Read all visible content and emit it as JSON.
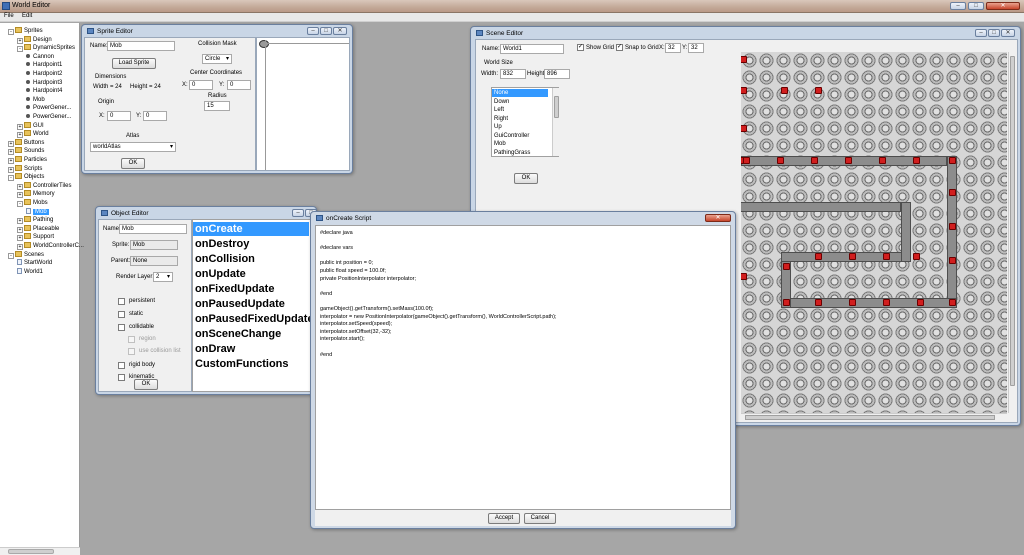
{
  "app": {
    "title": "World Editor"
  },
  "menu": [
    "File",
    "Edit"
  ],
  "tree": [
    {
      "label": "Sprites",
      "level": 0,
      "kind": "folder",
      "exp": "-"
    },
    {
      "label": "Design",
      "level": 1,
      "kind": "folder",
      "exp": "+"
    },
    {
      "label": "DynamicSprites",
      "level": 1,
      "kind": "folder",
      "exp": "-"
    },
    {
      "label": "Cannon",
      "level": 2,
      "kind": "bullet"
    },
    {
      "label": "Hardpoint1",
      "level": 2,
      "kind": "bullet"
    },
    {
      "label": "Hardpoint2",
      "level": 2,
      "kind": "bullet"
    },
    {
      "label": "Hardpoint3",
      "level": 2,
      "kind": "bullet"
    },
    {
      "label": "Hardpoint4",
      "level": 2,
      "kind": "bullet"
    },
    {
      "label": "Mob",
      "level": 2,
      "kind": "bullet"
    },
    {
      "label": "PowerGener...",
      "level": 2,
      "kind": "bullet"
    },
    {
      "label": "PowerGener...",
      "level": 2,
      "kind": "bullet"
    },
    {
      "label": "GUI",
      "level": 1,
      "kind": "folder",
      "exp": "+"
    },
    {
      "label": "World",
      "level": 1,
      "kind": "folder",
      "exp": "+"
    },
    {
      "label": "Buttons",
      "level": 0,
      "kind": "folder",
      "exp": "+"
    },
    {
      "label": "Sounds",
      "level": 0,
      "kind": "folder",
      "exp": "+"
    },
    {
      "label": "Particles",
      "level": 0,
      "kind": "folder",
      "exp": "+"
    },
    {
      "label": "Scripts",
      "level": 0,
      "kind": "folder",
      "exp": "+"
    },
    {
      "label": "Objects",
      "level": 0,
      "kind": "folder",
      "exp": "-"
    },
    {
      "label": "ControllerTiles",
      "level": 1,
      "kind": "folder",
      "exp": "+"
    },
    {
      "label": "Memory",
      "level": 1,
      "kind": "folder",
      "exp": "+"
    },
    {
      "label": "Mobs",
      "level": 1,
      "kind": "folder",
      "exp": "-"
    },
    {
      "label": "Mob",
      "level": 2,
      "kind": "page",
      "selected": true
    },
    {
      "label": "Pathing",
      "level": 1,
      "kind": "folder",
      "exp": "+"
    },
    {
      "label": "Placeable",
      "level": 1,
      "kind": "folder",
      "exp": "+"
    },
    {
      "label": "Support",
      "level": 1,
      "kind": "folder",
      "exp": "+"
    },
    {
      "label": "WorldControllerC...",
      "level": 1,
      "kind": "folder",
      "exp": "+"
    },
    {
      "label": "Scenes",
      "level": 0,
      "kind": "folder",
      "exp": "-"
    },
    {
      "label": "StartWorld",
      "level": 1,
      "kind": "page"
    },
    {
      "label": "World1",
      "level": 1,
      "kind": "page"
    }
  ],
  "sprite_editor": {
    "title": "Sprite Editor",
    "name_label": "Name:",
    "name_value": "Mob",
    "load_button": "Load Sprite",
    "dimensions_label": "Dimensions",
    "width_text": "Width = 24",
    "height_text": "Height = 24",
    "origin_label": "Origin",
    "origin_x_label": "X:",
    "origin_x": "0",
    "origin_y_label": "Y:",
    "origin_y": "0",
    "collision_label": "Collision Mask",
    "collision_value": "Circle",
    "center_label": "Center Coordinates",
    "center_x_label": "X:",
    "center_x": "0",
    "center_y_label": "Y:",
    "center_y": "0",
    "radius_label": "Radius",
    "radius_value": "15",
    "atlas_label": "Atlas",
    "atlas_value": "worldAtlas",
    "ok_button": "OK"
  },
  "object_editor": {
    "title": "Object Editor",
    "name_label": "Name:",
    "name_value": "Mob",
    "sprite_label": "Sprite:",
    "sprite_value": "Mob",
    "parent_label": "Parent:",
    "parent_value": "None",
    "render_label": "Render Layer:",
    "render_value": "2",
    "checks": [
      {
        "label": "persistent",
        "disabled": false
      },
      {
        "label": "static",
        "disabled": false
      },
      {
        "label": "collidable",
        "disabled": false
      },
      {
        "label": "region",
        "disabled": true
      },
      {
        "label": "use collision list",
        "disabled": true
      },
      {
        "label": "rigid body",
        "disabled": false
      },
      {
        "label": "kinematic",
        "disabled": false
      }
    ],
    "ok_button": "OK",
    "events": [
      "onCreate",
      "onDestroy",
      "onCollision",
      "onUpdate",
      "onFixedUpdate",
      "onPausedUpdate",
      "onPausedFixedUpdate",
      "onSceneChange",
      "onDraw",
      "CustomFunctions"
    ],
    "selected_event": "onCreate"
  },
  "script_dialog": {
    "title": "onCreate Script",
    "lines": [
      "#declare java",
      "",
      "#declare vars",
      "",
      "public int position = 0;",
      "public float speed = 100.0f;",
      "private PositionInterpolator interpolator;",
      "",
      "#end",
      "",
      "gameObject().getTransform().setMass(100.0f);",
      "interpolator = new PositionInterpolator(gameObject().getTransform(), WorldControllerScript.path);",
      "interpolator.setSpeed(speed);",
      "interpolator.setOffset(32,-32);",
      "interpolator.start();",
      "",
      "#end"
    ],
    "accept_button": "Accept",
    "cancel_button": "Cancel"
  },
  "scene_editor": {
    "title": "Scene Editor",
    "name_label": "Name:",
    "name_value": "World1",
    "show_grid_label": "Show Grid",
    "show_grid": true,
    "snap_label": "Snap to Grid",
    "snap": true,
    "snap_x_label": "X:",
    "snap_x": "32",
    "snap_y_label": "Y:",
    "snap_y": "32",
    "world_size_label": "World Size",
    "width_label": "Width:",
    "width_value": "832",
    "height_label": "Height:",
    "height_value": "896",
    "objects": [
      "None",
      "Down",
      "Left",
      "Right",
      "Up",
      "GuiController",
      "Mob",
      "PathingGrass"
    ],
    "selected_object": "None",
    "ok_button": "OK"
  },
  "colors": {
    "selection": "#3399ff",
    "window_frame": "#c9d6e6",
    "close_button": "#c7452b",
    "marker": "#d11e1e"
  }
}
